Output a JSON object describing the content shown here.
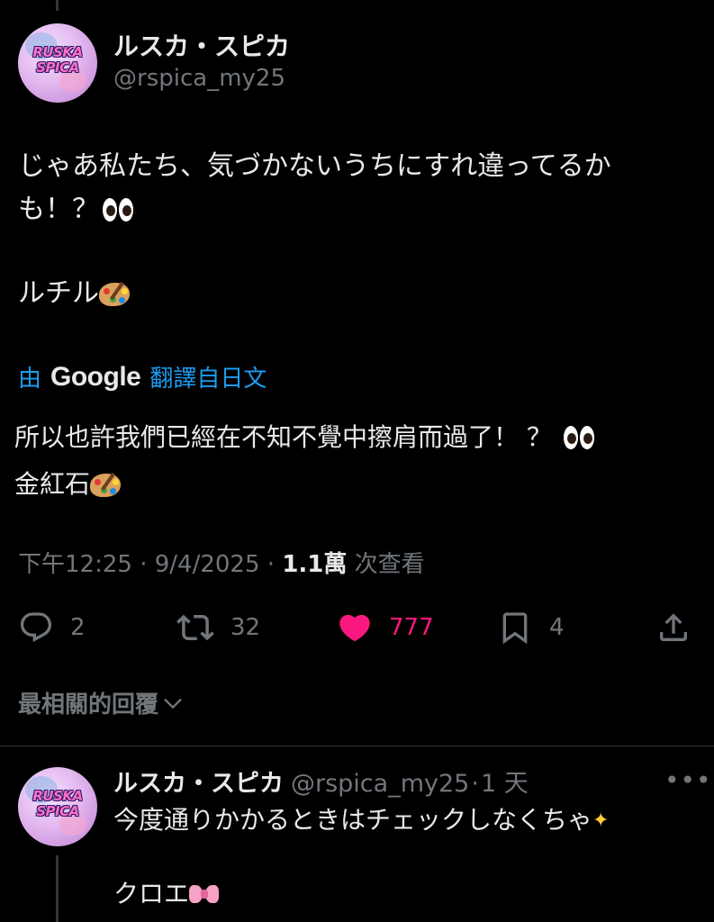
{
  "post": {
    "author": {
      "display_name": "ルスカ・スピカ",
      "handle": "@rspica_my25",
      "avatar_text_1": "RUSKA",
      "avatar_text_2": "SPICA"
    },
    "text_line1": "じゃあ私たち、気づかないうちにすれ違ってるか",
    "text_line2": "も！？",
    "text_line3": "ルチル",
    "translation": {
      "prefix": "由",
      "brand": "Google",
      "suffix": "翻譯自日文"
    },
    "translated_line1": "所以也許我們已經在不知不覺中擦肩而過了！ ？",
    "translated_line2": "金紅石",
    "time": "下午12:25",
    "date": "9/4/2025",
    "views": "1.1萬",
    "views_label": "次查看",
    "sep": "·",
    "actions": {
      "replies": "2",
      "reposts": "32",
      "likes": "777",
      "bookmarks": "4"
    },
    "replies_sort_label": "最相關的回覆"
  },
  "reply": {
    "display_name": "ルスカ・スピカ",
    "handle": "@rspica_my25",
    "age": "1 天",
    "sep": "·",
    "more": "•••",
    "text_line1": "今度通りかかるときはチェックしなくちゃ",
    "text_line2": "クロエ"
  },
  "colors": {
    "background": "#000000",
    "text": "#e7e9ea",
    "secondary": "#71767b",
    "link": "#1d9bf0",
    "like": "#f91880",
    "divider": "#2f3336"
  },
  "icons": [
    "reply-icon",
    "repost-icon",
    "heart-icon",
    "bookmark-icon",
    "share-icon",
    "chevron-down-icon",
    "eyes-emoji",
    "palette-emoji",
    "sparkles-emoji",
    "ribbon-emoji"
  ]
}
